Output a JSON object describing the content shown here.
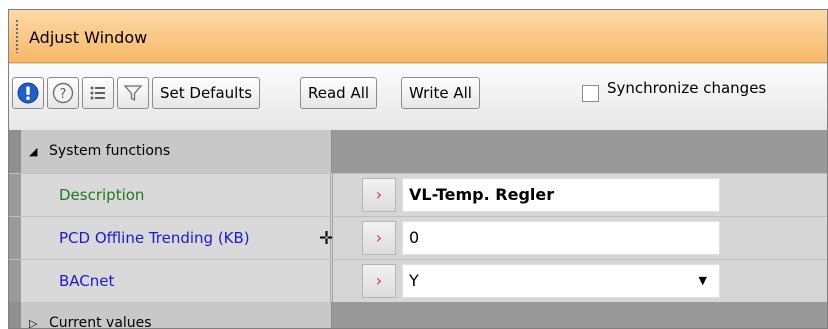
{
  "window": {
    "title": "Adjust Window"
  },
  "toolbar": {
    "info_icon": "info-icon",
    "help_icon": "help-icon",
    "list_icon": "list-icon",
    "filter_icon": "filter-icon",
    "set_defaults_label": "Set Defaults",
    "read_all_label": "Read All",
    "write_all_label": "Write All",
    "sync_label": "Synchronize changes",
    "sync_checked": false
  },
  "categories": {
    "system_functions": "System functions",
    "current_values": "Current values"
  },
  "properties": [
    {
      "name": "Description",
      "value": "VL-Temp. Regler"
    },
    {
      "name": "PCD Offline Trending (KB)",
      "value": "0"
    },
    {
      "name": "BACnet",
      "value": "Y"
    }
  ],
  "colors": {
    "title_bar": "#f7b866",
    "name_green": "#1e7a1e",
    "name_blue": "#1a1ad6",
    "chevron_red": "#d93a2a"
  }
}
